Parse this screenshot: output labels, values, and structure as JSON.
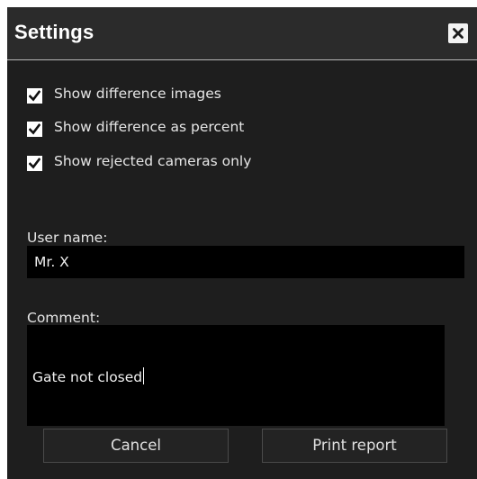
{
  "dialog": {
    "title": "Settings",
    "close_icon": "close-icon"
  },
  "options": [
    {
      "label": "Show difference images",
      "checked": true
    },
    {
      "label": "Show difference as percent",
      "checked": true
    },
    {
      "label": "Show rejected cameras only",
      "checked": true
    }
  ],
  "user": {
    "label": "User name:",
    "value": "Mr. X"
  },
  "comment": {
    "label": "Comment:",
    "value": "Gate not closed"
  },
  "buttons": {
    "cancel": "Cancel",
    "print": "Print report"
  },
  "colors": {
    "background": "#1e1e1e",
    "titlebar": "#2b2b2b",
    "field": "#000000",
    "text": "#e6e6e6",
    "checkbox": "#ffffff"
  }
}
